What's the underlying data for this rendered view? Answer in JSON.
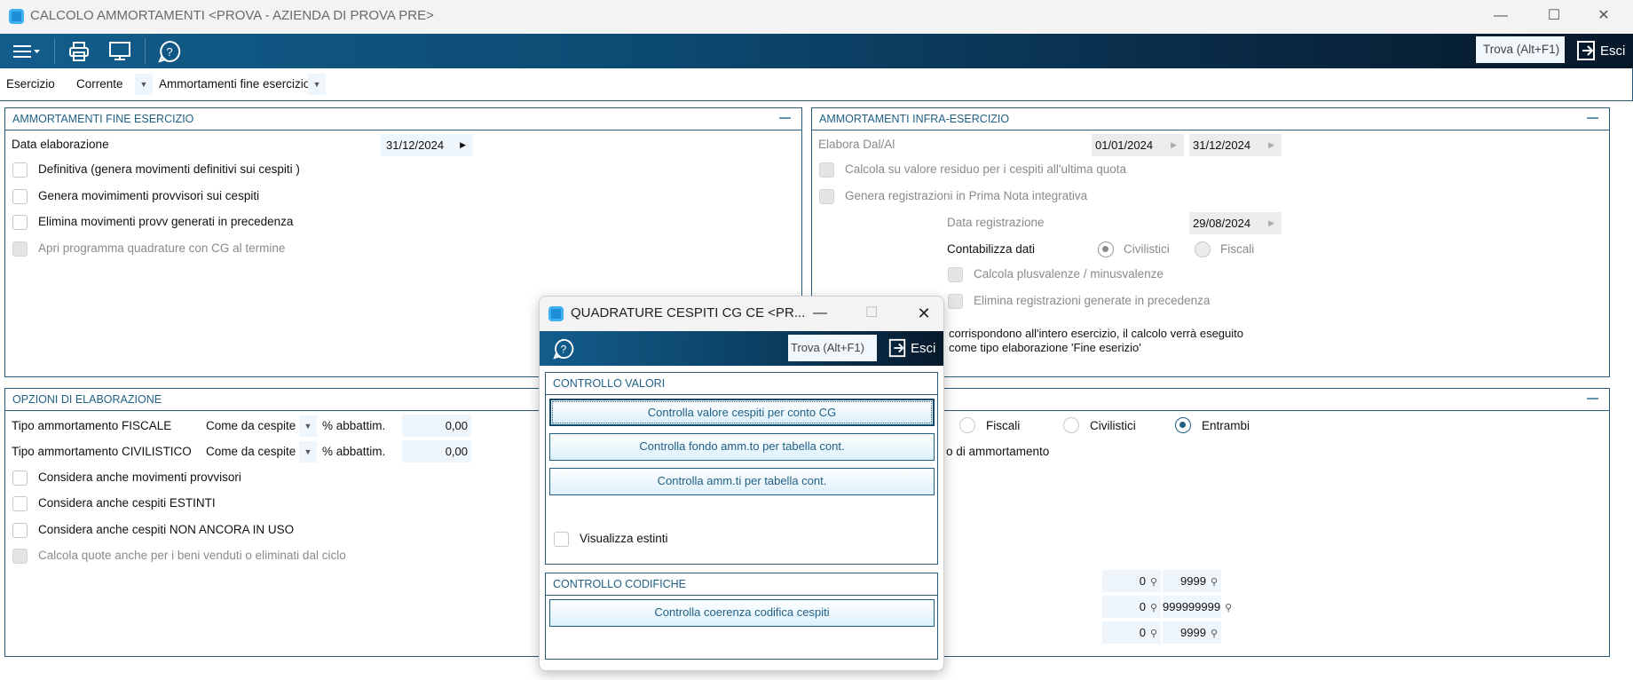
{
  "window": {
    "title": "CALCOLO AMMORTAMENTI <PROVA - AZIENDA DI PROVA PRE>"
  },
  "toolbar": {
    "search_placeholder": "Trova (Alt+F1)",
    "exit_label": "Esci"
  },
  "filterbar": {
    "esercizio_label": "Esercizio",
    "esercizio_value": "Corrente",
    "tipo_value": "Ammortamenti fine esercizio"
  },
  "panel_fine": {
    "title": "AMMORTAMENTI FINE ESERCIZIO",
    "data_label": "Data elaborazione",
    "data_value": "31/12/2024",
    "checks": [
      {
        "label": "Definitiva (genera movimenti definitivi sui cespiti )",
        "checked": false,
        "disabled": false
      },
      {
        "label": "Genera movimimenti provvisori sui cespiti",
        "checked": false,
        "disabled": false
      },
      {
        "label": "Elimina movimenti provv generati in precedenza",
        "checked": false,
        "disabled": false
      },
      {
        "label": "Apri programma quadrature con CG al termine",
        "checked": false,
        "disabled": true
      }
    ]
  },
  "panel_infra": {
    "title": "AMMORTAMENTI INFRA-ESERCIZIO",
    "elabora_label": "Elabora Dal/Al",
    "dal": "01/01/2024",
    "al": "31/12/2024",
    "check1": "Calcola su valore residuo per i cespiti all'ultima quota",
    "check2": "Genera registrazioni in Prima Nota integrativa",
    "data_reg_label": "Data registrazione",
    "data_reg_value": "29/08/2024",
    "contabilizza_label": "Contabilizza dati",
    "radio_civilistici": "Civilistici",
    "radio_fiscali": "Fiscali",
    "check3": "Calcola plusvalenze / minusvalenze",
    "check4": "Elimina registrazioni generate in precedenza",
    "note_line1": "corrispondono all'intero esercizio, il calcolo verrà eseguito",
    "note_line2": "come tipo elaborazione 'Fine eserizio'"
  },
  "panel_opzioni": {
    "title": "OPZIONI DI ELABORAZIONE",
    "fiscale_label": "Tipo ammortamento FISCALE",
    "fiscale_value": "Come da cespite",
    "civilistico_label": "Tipo ammortamento CIVILISTICO",
    "civilistico_value": "Come da cespite",
    "abbattim_label": "% abbattim.",
    "abbattim_fiscale": "0,00",
    "abbattim_civilistico": "0,00",
    "checks": [
      {
        "label": "Considera anche movimenti provvisori",
        "disabled": false
      },
      {
        "label": "Considera anche cespiti ESTINTI",
        "disabled": false
      },
      {
        "label": "Considera anche cespiti NON ANCORA IN USO",
        "disabled": false
      },
      {
        "label": "Calcola quote anche per i beni venduti o eliminati dal ciclo",
        "disabled": true
      }
    ],
    "radio_fiscali": "Fiscali",
    "radio_civilistici": "Civilistici",
    "radio_entrambi": "Entrambi",
    "selected_radio": "Entrambi",
    "partial_text": "o di ammortamento",
    "ranges": [
      {
        "from": "0",
        "to": "9999"
      },
      {
        "from": "0",
        "to": "999999999"
      },
      {
        "from": "0",
        "to": "9999"
      }
    ]
  },
  "dialog": {
    "title": "QUADRATURE CESPITI CG CE <PR...",
    "search_placeholder": "Trova (Alt+F1)",
    "exit_label": "Esci",
    "section1_title": "CONTROLLO VALORI",
    "btn1": "Controlla valore cespiti per conto CG",
    "btn2": "Controlla fondo amm.to per tabella cont.",
    "btn3": "Controlla  amm.ti per tabella cont.",
    "visualizza_estinti": "Visualizza estinti",
    "section2_title": "CONTROLLO CODIFICHE",
    "btn4": "Controlla coerenza codifica cespiti"
  },
  "colors": {
    "accent": "#1f5f85",
    "toolbar_dark": "#07182a",
    "field_bg": "#eef6fc"
  }
}
